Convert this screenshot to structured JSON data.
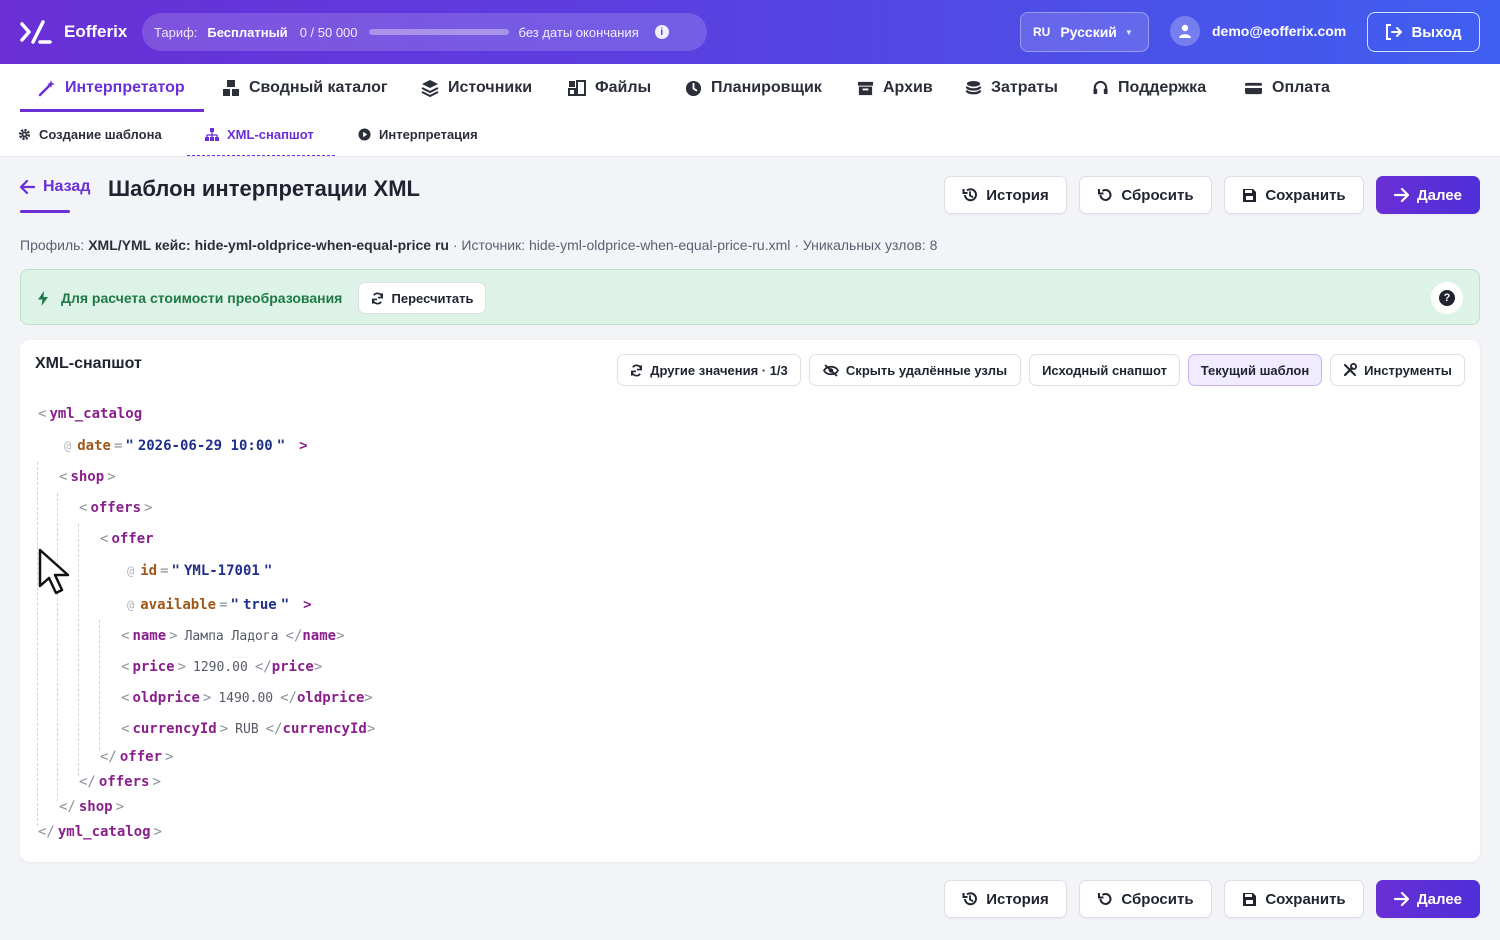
{
  "app": {
    "name": "Eofferix"
  },
  "tariff": {
    "label": "Тариф:",
    "plan": "Бесплатный",
    "usage": "0 / 50 000",
    "usage_fraction": 0,
    "expiry": "без даты окончания"
  },
  "lang": {
    "code": "RU",
    "name": "Русский"
  },
  "user": {
    "email": "demo@eofferix.com",
    "logout": "Выход"
  },
  "nav": [
    {
      "label": "Интерпретатор",
      "icon": "magic-wand-icon",
      "active": true
    },
    {
      "label": "Сводный каталог",
      "icon": "boxes-icon"
    },
    {
      "label": "Источники",
      "icon": "layers-icon"
    },
    {
      "label": "Файлы",
      "icon": "files-icon"
    },
    {
      "label": "Планировщик",
      "icon": "clock-icon"
    },
    {
      "label": "Архив",
      "icon": "archive-icon"
    },
    {
      "label": "Затраты",
      "icon": "coins-icon"
    },
    {
      "label": "Поддержка",
      "icon": "headset-icon"
    },
    {
      "label": "Оплата",
      "icon": "credit-card-icon"
    }
  ],
  "subnav": [
    {
      "label": "Создание шаблона",
      "icon": "gear-icon"
    },
    {
      "label": "XML-снапшот",
      "icon": "sitemap-icon",
      "active": true
    },
    {
      "label": "Интерпретация",
      "icon": "play-icon"
    }
  ],
  "header": {
    "back": "Назад",
    "title": "Шаблон интерпретации XML",
    "buttons": {
      "history": "История",
      "reset": "Сбросить",
      "save": "Сохранить",
      "next": "Далее"
    }
  },
  "profile": {
    "profile_label": "Профиль:",
    "profile_value": "XML/YML кейс: hide-yml-oldprice-when-equal-price ru",
    "source": "· Источник: hide-yml-oldprice-when-equal-price-ru.xml",
    "nodes": "· Уникальных узлов: 8"
  },
  "alert": {
    "text": "Для расчета стоимости преобразования",
    "button": "Пересчитать"
  },
  "card": {
    "title": "XML-снапшот",
    "tools": {
      "other_values": "Другие значения · 1/3",
      "hide_deleted": "Скрыть удалённые узлы",
      "original": "Исходный снапшот",
      "current": "Текущий шаблон",
      "instruments": "Инструменты"
    }
  },
  "xml": {
    "root": "yml_catalog",
    "date_attr": "date",
    "date_val": "2026-06-29 10:00",
    "shop": "shop",
    "offers": "offers",
    "offer": "offer",
    "id_attr": "id",
    "id_val": "YML-17001",
    "avail_attr": "available",
    "avail_val": "true",
    "name_tag": "name",
    "name_val": "Лампа Ладога",
    "price_tag": "price",
    "price_val": "1290.00",
    "oldprice_tag": "oldprice",
    "oldprice_val": "1490.00",
    "currency_tag": "currencyId",
    "currency_val": "RUB"
  },
  "colors": {
    "accent": "#6a2fd6",
    "success_bg": "#def3e7",
    "tag": "#8a1f8c",
    "attr": "#a0571a",
    "value": "#1f2f8a"
  }
}
